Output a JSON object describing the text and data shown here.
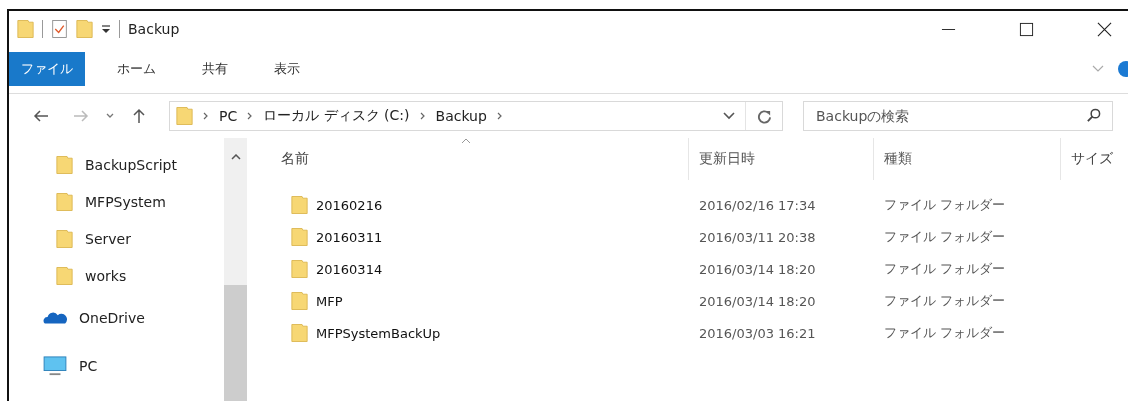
{
  "window": {
    "title": "Backup"
  },
  "ribbon_tabs": [
    {
      "label": "ファイル",
      "selected": true
    },
    {
      "label": "ホーム",
      "selected": false
    },
    {
      "label": "共有",
      "selected": false
    },
    {
      "label": "表示",
      "selected": false
    }
  ],
  "address_bar": {
    "crumbs": [
      "PC",
      "ローカル ディスク (C:)",
      "Backup"
    ]
  },
  "search": {
    "placeholder": "Backupの検索"
  },
  "navigation_pane": [
    {
      "kind": "folder",
      "label": "BackupScript"
    },
    {
      "kind": "folder",
      "label": "MFPSystem"
    },
    {
      "kind": "folder",
      "label": "Server"
    },
    {
      "kind": "folder",
      "label": "works"
    },
    {
      "kind": "cloud",
      "label": "OneDrive"
    },
    {
      "kind": "computer",
      "label": "PC"
    }
  ],
  "table": {
    "columns": [
      "名前",
      "更新日時",
      "種類",
      "サイズ"
    ],
    "rows": [
      {
        "name": "20160216",
        "modified": "2016/02/16 17:34",
        "type": "ファイル フォルダー"
      },
      {
        "name": "20160311",
        "modified": "2016/03/11 20:38",
        "type": "ファイル フォルダー"
      },
      {
        "name": "20160314",
        "modified": "2016/03/14 18:20",
        "type": "ファイル フォルダー"
      },
      {
        "name": "MFP",
        "modified": "2016/03/14 18:20",
        "type": "ファイル フォルダー"
      },
      {
        "name": "MFPSystemBackUp",
        "modified": "2016/03/03 16:21",
        "type": "ファイル フォルダー"
      }
    ]
  }
}
